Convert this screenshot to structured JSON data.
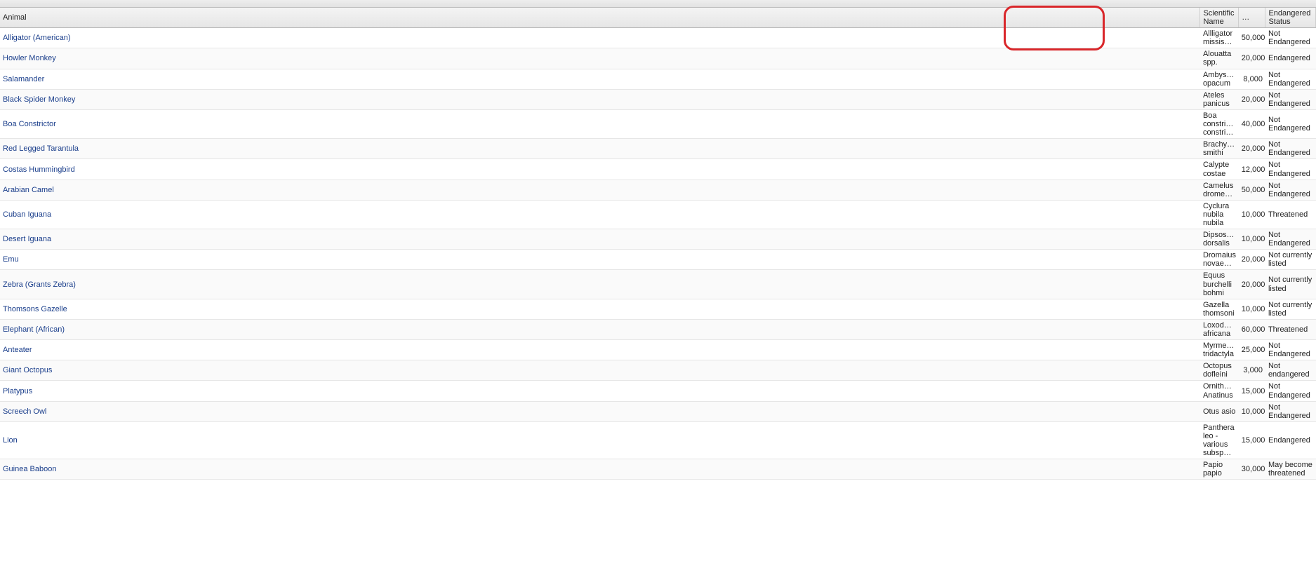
{
  "headers": {
    "animal": "Animal",
    "scientific": "Scientific Name",
    "population": "…",
    "status": "Endangered Status"
  },
  "rows": [
    {
      "animal": "Alligator (American)",
      "scientific": "Allligator missis…",
      "population": "50,000",
      "status": "Not Endangered"
    },
    {
      "animal": "Howler Monkey",
      "scientific": "Alouatta spp.",
      "population": "20,000",
      "status": "Endangered"
    },
    {
      "animal": "Salamander",
      "scientific": "Ambys… opacum",
      "population": "8,000",
      "status": "Not Endangered"
    },
    {
      "animal": "Black Spider Monkey",
      "scientific": "Ateles panicus",
      "population": "20,000",
      "status": "Not Endangered"
    },
    {
      "animal": "Boa Constrictor",
      "scientific": "Boa constri… constri…",
      "population": "40,000",
      "status": "Not Endangered"
    },
    {
      "animal": "Red Legged Tarantula",
      "scientific": "Brachy… smithi",
      "population": "20,000",
      "status": "Not Endangered"
    },
    {
      "animal": "Costas Hummingbird",
      "scientific": "Calypte costae",
      "population": "12,000",
      "status": "Not Endangered"
    },
    {
      "animal": "Arabian Camel",
      "scientific": "Camelus drome…",
      "population": "50,000",
      "status": "Not Endangered"
    },
    {
      "animal": "Cuban Iguana",
      "scientific": "Cyclura nubila nubila",
      "population": "10,000",
      "status": "Threatened"
    },
    {
      "animal": "Desert Iguana",
      "scientific": "Dipsos… dorsalis",
      "population": "10,000",
      "status": "Not Endangered"
    },
    {
      "animal": "Emu",
      "scientific": "Dromaius novae…",
      "population": "20,000",
      "status": "Not currently listed"
    },
    {
      "animal": "Zebra (Grants Zebra)",
      "scientific": "Equus burchelli bohmi",
      "population": "20,000",
      "status": "Not currently listed"
    },
    {
      "animal": "Thomsons Gazelle",
      "scientific": "Gazella thomsoni",
      "population": "10,000",
      "status": "Not currently listed"
    },
    {
      "animal": "Elephant (African)",
      "scientific": "Loxod… africana",
      "population": "60,000",
      "status": "Threatened"
    },
    {
      "animal": "Anteater",
      "scientific": "Myrme… tridactyla",
      "population": "25,000",
      "status": "Not Endangered"
    },
    {
      "animal": "Giant Octopus",
      "scientific": "Octopus dofleini",
      "population": "3,000",
      "status": "Not endangered"
    },
    {
      "animal": "Platypus",
      "scientific": "Ornith… Anatinus",
      "population": "15,000",
      "status": "Not Endangered"
    },
    {
      "animal": "Screech Owl",
      "scientific": "Otus asio",
      "population": "10,000",
      "status": "Not Endangered"
    },
    {
      "animal": "Lion",
      "scientific": "Panthera leo - various subsp…",
      "population": "15,000",
      "status": "Endangered"
    },
    {
      "animal": "Guinea Baboon",
      "scientific": "Papio papio",
      "population": "30,000",
      "status": "May become threatened"
    }
  ]
}
